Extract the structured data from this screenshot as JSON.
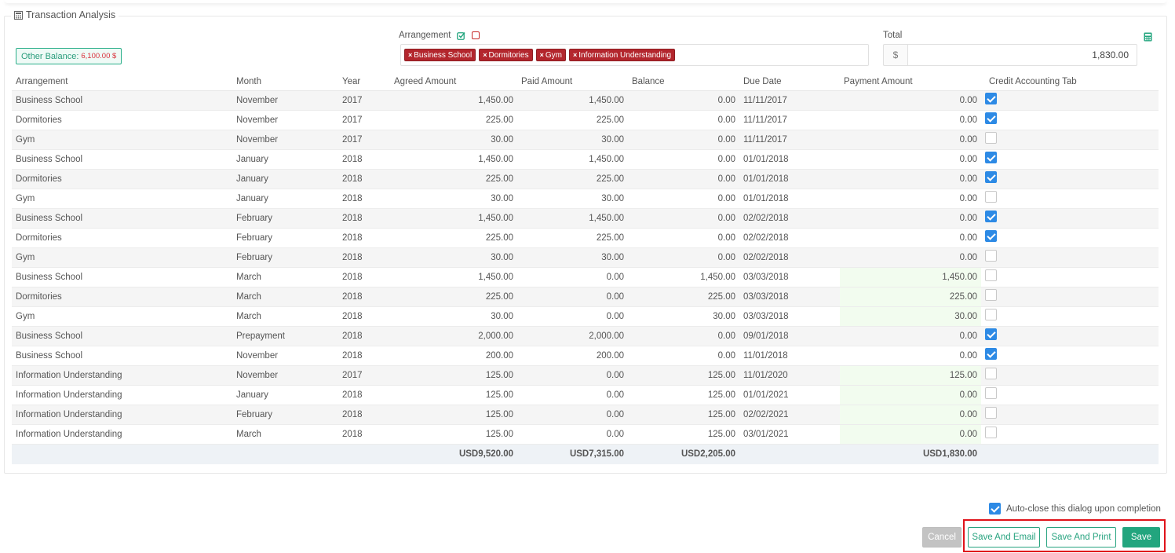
{
  "panel": {
    "title": "Transaction Analysis",
    "other_balance_label": "Other Balance:",
    "other_balance_value": "6,100.00 $"
  },
  "arrangement_filter": {
    "label": "Arrangement",
    "tags": [
      "Business School",
      "Dormitories",
      "Gym",
      "Information Understanding"
    ]
  },
  "total": {
    "label": "Total",
    "currency_symbol": "$",
    "value": "1,830.00"
  },
  "table": {
    "columns": [
      "Arrangement",
      "Month",
      "Year",
      "Agreed Amount",
      "Paid Amount",
      "Balance",
      "Due Date",
      "Payment Amount",
      "Credit Accounting Tab"
    ],
    "rows": [
      {
        "arrangement": "Business School",
        "month": "November",
        "year": "2017",
        "agreed": "1,450.00",
        "paid": "1,450.00",
        "balance": "0.00",
        "due": "11/11/2017",
        "payment": "0.00",
        "credit": true,
        "editable": false
      },
      {
        "arrangement": "Dormitories",
        "month": "November",
        "year": "2017",
        "agreed": "225.00",
        "paid": "225.00",
        "balance": "0.00",
        "due": "11/11/2017",
        "payment": "0.00",
        "credit": true,
        "editable": false
      },
      {
        "arrangement": "Gym",
        "month": "November",
        "year": "2017",
        "agreed": "30.00",
        "paid": "30.00",
        "balance": "0.00",
        "due": "11/11/2017",
        "payment": "0.00",
        "credit": false,
        "editable": false
      },
      {
        "arrangement": "Business School",
        "month": "January",
        "year": "2018",
        "agreed": "1,450.00",
        "paid": "1,450.00",
        "balance": "0.00",
        "due": "01/01/2018",
        "payment": "0.00",
        "credit": true,
        "editable": false
      },
      {
        "arrangement": "Dormitories",
        "month": "January",
        "year": "2018",
        "agreed": "225.00",
        "paid": "225.00",
        "balance": "0.00",
        "due": "01/01/2018",
        "payment": "0.00",
        "credit": true,
        "editable": false
      },
      {
        "arrangement": "Gym",
        "month": "January",
        "year": "2018",
        "agreed": "30.00",
        "paid": "30.00",
        "balance": "0.00",
        "due": "01/01/2018",
        "payment": "0.00",
        "credit": false,
        "editable": false
      },
      {
        "arrangement": "Business School",
        "month": "February",
        "year": "2018",
        "agreed": "1,450.00",
        "paid": "1,450.00",
        "balance": "0.00",
        "due": "02/02/2018",
        "payment": "0.00",
        "credit": true,
        "editable": false
      },
      {
        "arrangement": "Dormitories",
        "month": "February",
        "year": "2018",
        "agreed": "225.00",
        "paid": "225.00",
        "balance": "0.00",
        "due": "02/02/2018",
        "payment": "0.00",
        "credit": true,
        "editable": false
      },
      {
        "arrangement": "Gym",
        "month": "February",
        "year": "2018",
        "agreed": "30.00",
        "paid": "30.00",
        "balance": "0.00",
        "due": "02/02/2018",
        "payment": "0.00",
        "credit": false,
        "editable": false
      },
      {
        "arrangement": "Business School",
        "month": "March",
        "year": "2018",
        "agreed": "1,450.00",
        "paid": "0.00",
        "balance": "1,450.00",
        "due": "03/03/2018",
        "payment": "1,450.00",
        "credit": false,
        "editable": true
      },
      {
        "arrangement": "Dormitories",
        "month": "March",
        "year": "2018",
        "agreed": "225.00",
        "paid": "0.00",
        "balance": "225.00",
        "due": "03/03/2018",
        "payment": "225.00",
        "credit": false,
        "editable": true
      },
      {
        "arrangement": "Gym",
        "month": "March",
        "year": "2018",
        "agreed": "30.00",
        "paid": "0.00",
        "balance": "30.00",
        "due": "03/03/2018",
        "payment": "30.00",
        "credit": false,
        "editable": true
      },
      {
        "arrangement": "Business School",
        "month": "Prepayment",
        "year": "2018",
        "agreed": "2,000.00",
        "paid": "2,000.00",
        "balance": "0.00",
        "due": "09/01/2018",
        "payment": "0.00",
        "credit": true,
        "editable": false
      },
      {
        "arrangement": "Business School",
        "month": "November",
        "year": "2018",
        "agreed": "200.00",
        "paid": "200.00",
        "balance": "0.00",
        "due": "11/01/2018",
        "payment": "0.00",
        "credit": true,
        "editable": false
      },
      {
        "arrangement": "Information Understanding",
        "month": "November",
        "year": "2017",
        "agreed": "125.00",
        "paid": "0.00",
        "balance": "125.00",
        "due": "11/01/2020",
        "payment": "125.00",
        "credit": false,
        "editable": true
      },
      {
        "arrangement": "Information Understanding",
        "month": "January",
        "year": "2018",
        "agreed": "125.00",
        "paid": "0.00",
        "balance": "125.00",
        "due": "01/01/2021",
        "payment": "0.00",
        "credit": false,
        "editable": true
      },
      {
        "arrangement": "Information Understanding",
        "month": "February",
        "year": "2018",
        "agreed": "125.00",
        "paid": "0.00",
        "balance": "125.00",
        "due": "02/02/2021",
        "payment": "0.00",
        "credit": false,
        "editable": true
      },
      {
        "arrangement": "Information Understanding",
        "month": "March",
        "year": "2018",
        "agreed": "125.00",
        "paid": "0.00",
        "balance": "125.00",
        "due": "03/01/2021",
        "payment": "0.00",
        "credit": false,
        "editable": true
      }
    ],
    "totals": {
      "agreed": "USD9,520.00",
      "paid": "USD7,315.00",
      "balance": "USD2,205.00",
      "payment": "USD1,830.00"
    }
  },
  "footer": {
    "autoclose_label": "Auto-close this dialog upon completion",
    "autoclose_checked": true,
    "cancel_label": "Cancel",
    "save_email_label": "Save And Email",
    "save_print_label": "Save And Print",
    "save_label": "Save"
  },
  "colors": {
    "tag_red": "#b3262d",
    "accent_green": "#22a57e",
    "checkbox_blue": "#2d8ae5",
    "highlight_red": "#e0131a"
  }
}
